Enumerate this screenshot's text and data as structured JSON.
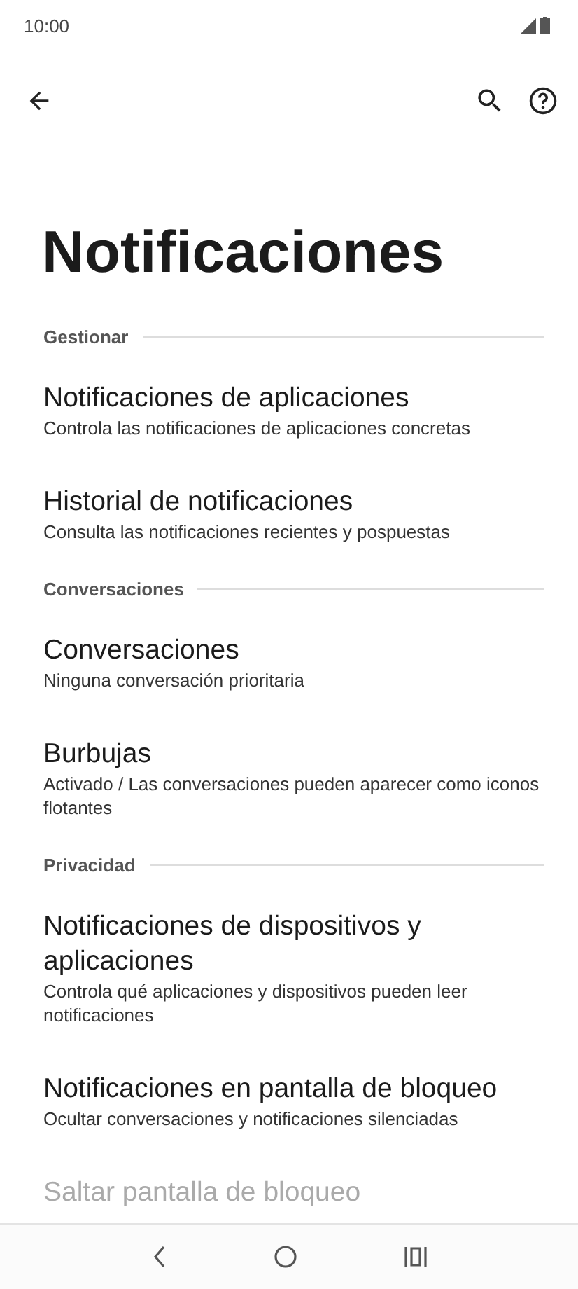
{
  "status_bar": {
    "time": "10:00"
  },
  "title": "Notificaciones",
  "sections": [
    {
      "header": "Gestionar",
      "items": [
        {
          "kind": "link",
          "title": "Notificaciones de aplicaciones",
          "summary": "Controla las notificaciones de aplicaciones concretas",
          "disabled": false
        },
        {
          "kind": "link",
          "title": "Historial de notificaciones",
          "summary": "Consulta las notificaciones recientes y pospuestas",
          "disabled": false
        }
      ]
    },
    {
      "header": "Conversaciones",
      "items": [
        {
          "kind": "link",
          "title": "Conversaciones",
          "summary": "Ninguna conversación prioritaria",
          "disabled": false
        },
        {
          "kind": "link",
          "title": "Burbujas",
          "summary": "Activado / Las conversaciones pueden aparecer como iconos flotantes",
          "disabled": false
        }
      ]
    },
    {
      "header": "Privacidad",
      "items": [
        {
          "kind": "link",
          "title": "Notificaciones de dispositivos y aplicaciones",
          "summary": "Controla qué aplicaciones y dispositivos pueden leer notificaciones",
          "disabled": false
        },
        {
          "kind": "link",
          "title": "Notificaciones en pantalla de bloqueo",
          "summary": "Ocultar conversaciones y notificaciones silenciadas",
          "disabled": false
        },
        {
          "kind": "partial",
          "title": "Saltar pantalla de bloqueo",
          "disabled": true
        }
      ]
    }
  ]
}
